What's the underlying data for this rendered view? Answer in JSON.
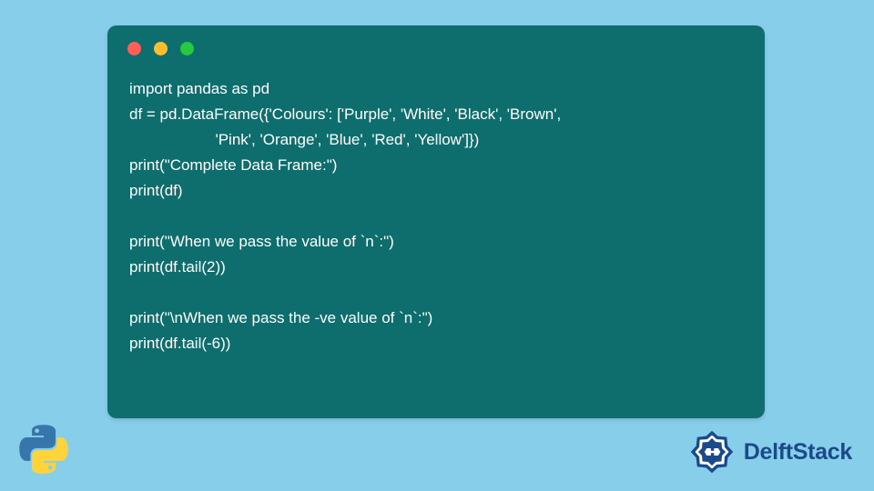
{
  "code": {
    "lines": [
      "import pandas as pd",
      "df = pd.DataFrame({'Colours': ['Purple', 'White', 'Black', 'Brown',",
      "                    'Pink', 'Orange', 'Blue', 'Red', 'Yellow']})",
      "print(\"Complete Data Frame:\")",
      "print(df)",
      "",
      "print(\"When we pass the value of `n`:\")",
      "print(df.tail(2))",
      "",
      "print(\"\\nWhen we pass the -ve value of `n`:\")",
      "print(df.tail(-6))"
    ]
  },
  "brand": {
    "name": "DelftStack"
  },
  "colors": {
    "bg": "#87ceeb",
    "card": "#0e6d6d",
    "red": "#ff5f56",
    "yellow": "#ffbd2e",
    "green": "#27c93f",
    "brand_text": "#1a4a8a"
  }
}
